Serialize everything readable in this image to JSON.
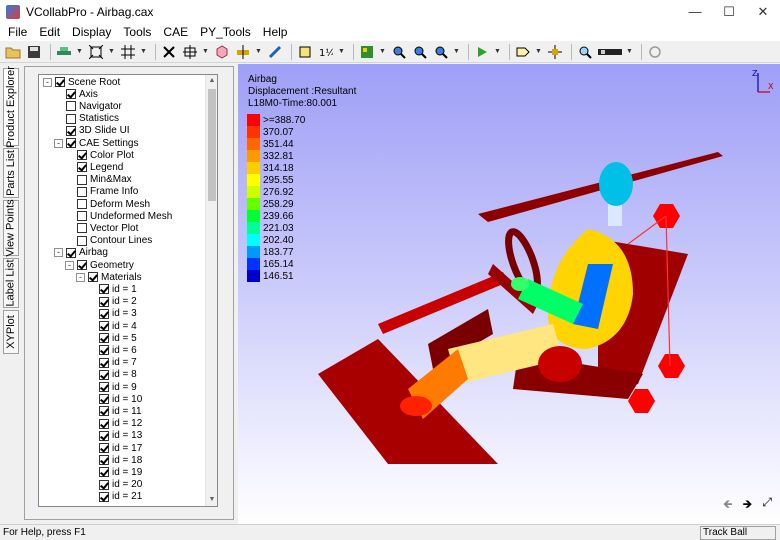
{
  "window": {
    "title": "VCollabPro - Airbag.cax"
  },
  "menu": [
    "File",
    "Edit",
    "Display",
    "Tools",
    "CAE",
    "PY_Tools",
    "Help"
  ],
  "side_tabs": [
    "Product Explorer",
    "Parts List",
    "View Points",
    "Label List",
    "XYPlot"
  ],
  "tree": {
    "rows": [
      {
        "label": "Scene Root",
        "indent": 0,
        "expander": "-",
        "checked": true
      },
      {
        "label": "Axis",
        "indent": 1,
        "expander": "",
        "checked": true
      },
      {
        "label": "Navigator",
        "indent": 1,
        "expander": "",
        "checked": false
      },
      {
        "label": "Statistics",
        "indent": 1,
        "expander": "",
        "checked": false
      },
      {
        "label": "3D Slide UI",
        "indent": 1,
        "expander": "",
        "checked": true
      },
      {
        "label": "CAE Settings",
        "indent": 1,
        "expander": "-",
        "checked": true
      },
      {
        "label": "Color Plot",
        "indent": 2,
        "expander": "",
        "checked": true
      },
      {
        "label": "Legend",
        "indent": 2,
        "expander": "",
        "checked": true
      },
      {
        "label": "Min&Max",
        "indent": 2,
        "expander": "",
        "checked": false
      },
      {
        "label": "Frame Info",
        "indent": 2,
        "expander": "",
        "checked": false
      },
      {
        "label": "Deform Mesh",
        "indent": 2,
        "expander": "",
        "checked": false
      },
      {
        "label": "Undeformed Mesh",
        "indent": 2,
        "expander": "",
        "checked": false
      },
      {
        "label": "Vector Plot",
        "indent": 2,
        "expander": "",
        "checked": false
      },
      {
        "label": "Contour Lines",
        "indent": 2,
        "expander": "",
        "checked": false
      },
      {
        "label": "Airbag",
        "indent": 1,
        "expander": "-",
        "checked": true
      },
      {
        "label": "Geometry",
        "indent": 2,
        "expander": "-",
        "checked": true
      },
      {
        "label": "Materials",
        "indent": 3,
        "expander": "-",
        "checked": true
      },
      {
        "label": "id = 1",
        "indent": 4,
        "expander": "",
        "checked": true
      },
      {
        "label": "id = 2",
        "indent": 4,
        "expander": "",
        "checked": true
      },
      {
        "label": "id = 3",
        "indent": 4,
        "expander": "",
        "checked": true
      },
      {
        "label": "id = 4",
        "indent": 4,
        "expander": "",
        "checked": true
      },
      {
        "label": "id = 5",
        "indent": 4,
        "expander": "",
        "checked": true
      },
      {
        "label": "id = 6",
        "indent": 4,
        "expander": "",
        "checked": true
      },
      {
        "label": "id = 7",
        "indent": 4,
        "expander": "",
        "checked": true
      },
      {
        "label": "id = 8",
        "indent": 4,
        "expander": "",
        "checked": true
      },
      {
        "label": "id = 9",
        "indent": 4,
        "expander": "",
        "checked": true
      },
      {
        "label": "id = 10",
        "indent": 4,
        "expander": "",
        "checked": true
      },
      {
        "label": "id = 11",
        "indent": 4,
        "expander": "",
        "checked": true
      },
      {
        "label": "id = 12",
        "indent": 4,
        "expander": "",
        "checked": true
      },
      {
        "label": "id = 13",
        "indent": 4,
        "expander": "",
        "checked": true
      },
      {
        "label": "id = 17",
        "indent": 4,
        "expander": "",
        "checked": true
      },
      {
        "label": "id = 18",
        "indent": 4,
        "expander": "",
        "checked": true
      },
      {
        "label": "id = 19",
        "indent": 4,
        "expander": "",
        "checked": true
      },
      {
        "label": "id = 20",
        "indent": 4,
        "expander": "",
        "checked": true
      },
      {
        "label": "id = 21",
        "indent": 4,
        "expander": "",
        "checked": true
      }
    ]
  },
  "viewport": {
    "model_name": "Airbag",
    "result": "Displacement :Resultant",
    "frame": "L18M0-Time:80.001",
    "legend": [
      {
        "label": ">=388.70",
        "color": "#ff0000"
      },
      {
        "label": "370.07",
        "color": "#ff3300"
      },
      {
        "label": "351.44",
        "color": "#ff6600"
      },
      {
        "label": "332.81",
        "color": "#ff9900"
      },
      {
        "label": "314.18",
        "color": "#ffcc00"
      },
      {
        "label": "295.55",
        "color": "#ffff00"
      },
      {
        "label": "276.92",
        "color": "#ccff00"
      },
      {
        "label": "258.29",
        "color": "#66ff00"
      },
      {
        "label": "239.66",
        "color": "#00ff33"
      },
      {
        "label": "221.03",
        "color": "#00ff99"
      },
      {
        "label": "202.40",
        "color": "#00ffff"
      },
      {
        "label": "183.77",
        "color": "#0099ff"
      },
      {
        "label": "165.14",
        "color": "#0033ff"
      },
      {
        "label": "146.51",
        "color": "#0000cc"
      }
    ],
    "axis_labels": {
      "z": "Z",
      "x": "X"
    }
  },
  "status": {
    "help": "For Help, press F1",
    "mode": "Track Ball"
  }
}
